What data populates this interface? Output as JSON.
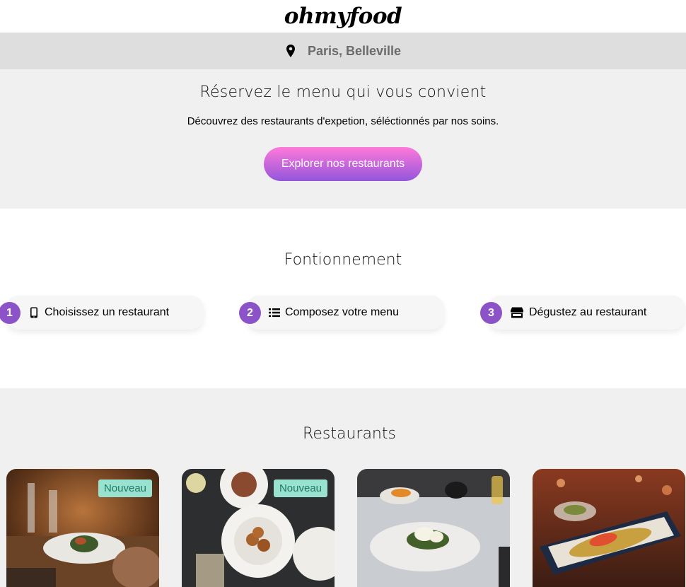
{
  "header": {
    "logo": "ohmyfood"
  },
  "location": {
    "icon": "map-pin-icon",
    "text": "Paris, Belleville"
  },
  "hero": {
    "title": "Réservez le menu qui vous convient",
    "subtitle": "Découvrez des restaurants d'expetion, séléctionnés par nos soins.",
    "cta_label": "Explorer nos restaurants"
  },
  "how": {
    "title": "Fontionnement",
    "steps": [
      {
        "number": "1",
        "icon": "smartphone-icon",
        "label": "Choisissez un restaurant"
      },
      {
        "number": "2",
        "icon": "list-icon",
        "label": "Composez votre menu"
      },
      {
        "number": "3",
        "icon": "storefront-icon",
        "label": "Dégustez au restaurant"
      }
    ]
  },
  "restaurants": {
    "title": "Restaurants",
    "cards": [
      {
        "badge": "Nouveau"
      },
      {
        "badge": "Nouveau"
      },
      {
        "badge": ""
      },
      {
        "badge": ""
      }
    ]
  },
  "colors": {
    "accent": "#9356dc",
    "accent_pink": "#ff79da",
    "badge_bg": "#99e2d0"
  }
}
